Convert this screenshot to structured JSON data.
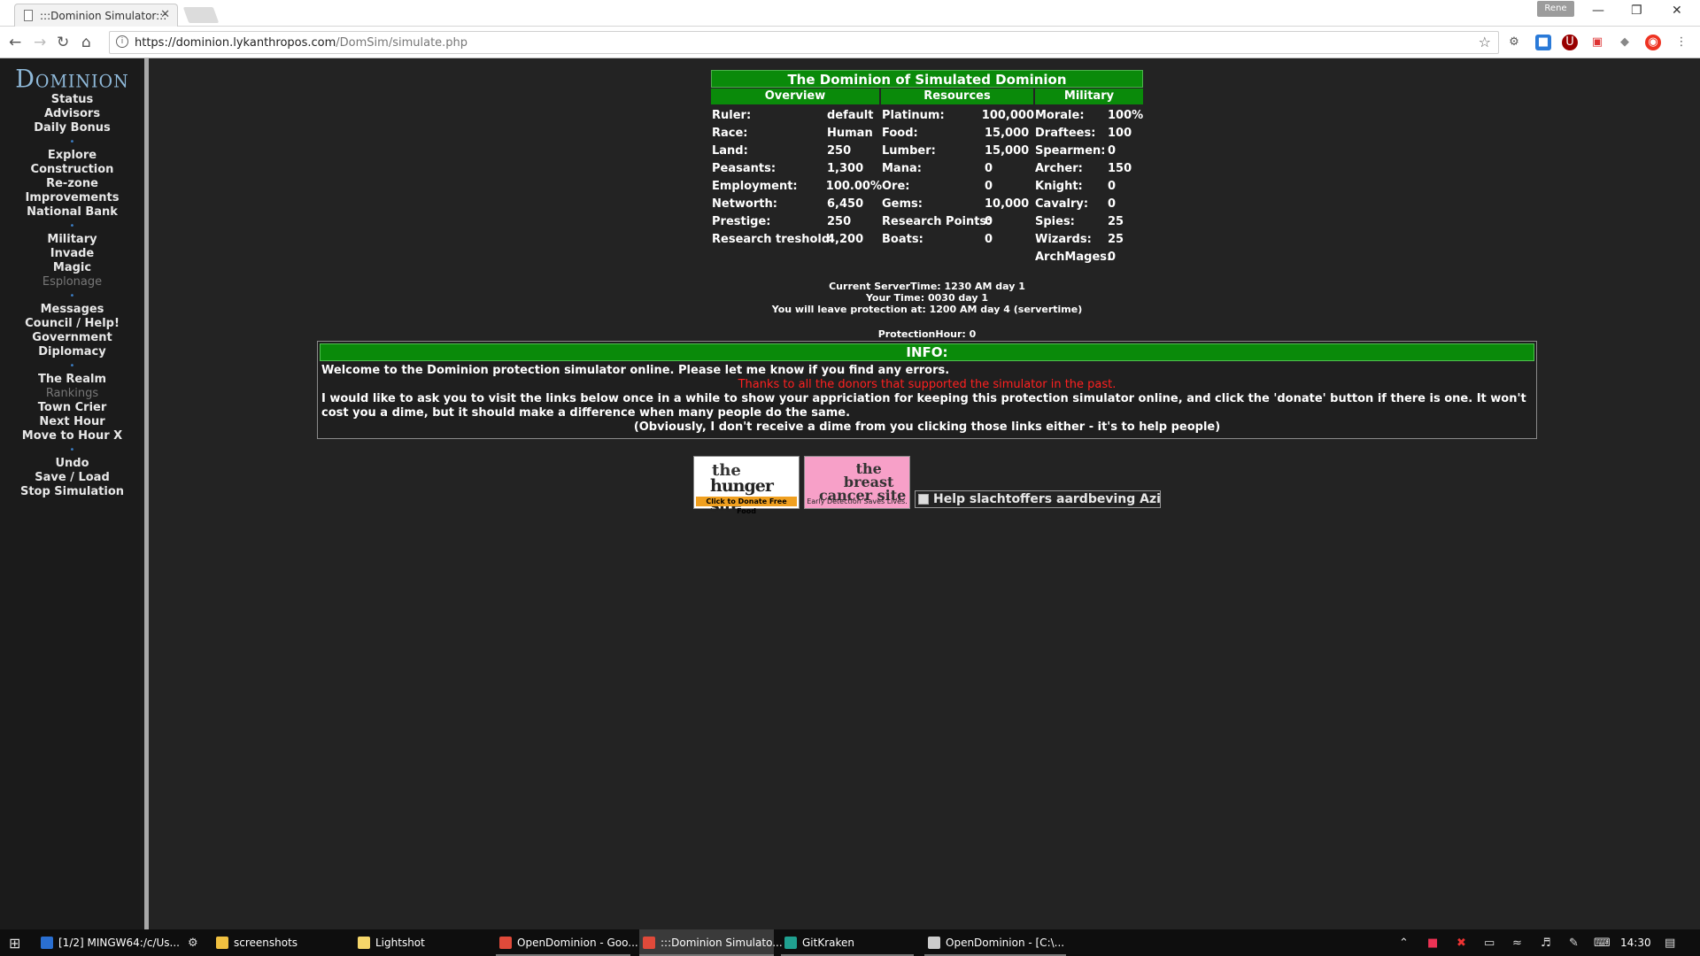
{
  "browser": {
    "tab_title": ":::Dominion Simulator:::",
    "tab_close": "✕",
    "profile": "Rene",
    "url_host": "https://dominion.lykanthropos.com",
    "url_path": "/DomSim/simulate.php",
    "info_glyph": "i",
    "icons": [
      "back-icon",
      "forward-icon",
      "reload-icon",
      "home-icon",
      "star-icon",
      "menu-icon"
    ]
  },
  "sidebar": {
    "logo": "Dominion",
    "groups": [
      [
        {
          "label": "Status"
        },
        {
          "label": "Advisors"
        },
        {
          "label": "Daily Bonus"
        }
      ],
      [
        {
          "label": "Explore"
        },
        {
          "label": "Construction"
        },
        {
          "label": "Re-zone"
        },
        {
          "label": "Improvements"
        },
        {
          "label": "National Bank"
        }
      ],
      [
        {
          "label": "Military"
        },
        {
          "label": "Invade"
        },
        {
          "label": "Magic"
        },
        {
          "label": "Esplonage",
          "disabled": true
        }
      ],
      [
        {
          "label": "Messages"
        },
        {
          "label": "Council / Help!"
        },
        {
          "label": "Government"
        },
        {
          "label": "Diplomacy"
        }
      ],
      [
        {
          "label": "The Realm"
        },
        {
          "label": "Rankings",
          "disabled": true
        },
        {
          "label": "Town Crier"
        },
        {
          "label": "Next Hour"
        },
        {
          "label": "Move to Hour X"
        }
      ],
      [
        {
          "label": "Undo"
        },
        {
          "label": "Save / Load"
        },
        {
          "label": "Stop Simulation"
        }
      ]
    ],
    "separator": "•"
  },
  "status": {
    "title": "The Dominion of Simulated Dominion",
    "headers": [
      "Overview",
      "Resources",
      "Military"
    ],
    "overview": [
      {
        "k": "Ruler:",
        "v": "default"
      },
      {
        "k": "Race:",
        "v": "Human"
      },
      {
        "k": "Land:",
        "v": "250"
      },
      {
        "k": "Peasants:",
        "v": "1,300"
      },
      {
        "k": "Employment:",
        "v": "100.00%"
      },
      {
        "k": "Networth:",
        "v": "6,450"
      },
      {
        "k": "Prestige:",
        "v": "250"
      },
      {
        "k": "Research treshold:",
        "v": "4,200"
      }
    ],
    "resources": [
      {
        "k": "Platinum:",
        "v": "100,000"
      },
      {
        "k": "Food:",
        "v": "15,000"
      },
      {
        "k": "Lumber:",
        "v": "15,000"
      },
      {
        "k": "Mana:",
        "v": "0"
      },
      {
        "k": "Ore:",
        "v": "0"
      },
      {
        "k": "Gems:",
        "v": "10,000"
      },
      {
        "k": "Research Points:",
        "v": "0"
      },
      {
        "k": "Boats:",
        "v": "0"
      }
    ],
    "military": [
      {
        "k": "Morale:",
        "v": "100%"
      },
      {
        "k": "Draftees:",
        "v": "100"
      },
      {
        "k": "Spearmen:",
        "v": "0"
      },
      {
        "k": "Archer:",
        "v": "150"
      },
      {
        "k": "Knight:",
        "v": "0"
      },
      {
        "k": "Cavalry:",
        "v": "0"
      },
      {
        "k": "Spies:",
        "v": "25"
      },
      {
        "k": "Wizards:",
        "v": "25"
      },
      {
        "k": "ArchMages:",
        "v": "0"
      }
    ]
  },
  "times": {
    "server": "Current ServerTime: 1230 AM day 1",
    "yours": "Your Time: 0030 day 1",
    "leave": "You will leave protection at: 1200 AM day 4 (servertime)",
    "protection_hour": "ProtectionHour: 0"
  },
  "info": {
    "title": "INFO:",
    "welcome": "Welcome to the Dominion protection simulator online. Please let me know if you find any errors.",
    "thanks": "Thanks to all the donors that supported the simulator in the past.",
    "request": "I would like to ask you to visit the links below once in a while to show your appriciation for keeping this protection simulator online, and click the 'donate' button if there is one. It won't cost you a dime, but it should make a difference when many people do the same.",
    "obviously": "(Obviously, I don't receive a dime from you clicking those links either - it's to help people)"
  },
  "banners": {
    "hunger_line1": "the",
    "hunger_line2": "hunger site",
    "hunger_tag": "Click to Donate Free Food",
    "breast_line1": "the",
    "breast_line2": "breast",
    "breast_line3": "cancer site",
    "breast_tag": "Early Detection Saves Lives.",
    "aard_alt": "Help slachtoffers aardbeving Azi�"
  },
  "taskbar": {
    "items": [
      {
        "label": "[1/2] MINGW64:/c/Us...",
        "color": "#2a6fd1"
      },
      {
        "label": "screenshots",
        "color": "#f0c040"
      },
      {
        "label": "Lightshot",
        "color": "#f5d66a"
      },
      {
        "label": "OpenDominion - Goo...",
        "color": "#e04a3a"
      },
      {
        "label": ":::Dominion Simulato...",
        "color": "#e04a3a"
      },
      {
        "label": "GitKraken",
        "color": "#20a090"
      },
      {
        "label": "OpenDominion - [C:\\...",
        "color": "#cccccc"
      }
    ],
    "time": "14:30"
  }
}
